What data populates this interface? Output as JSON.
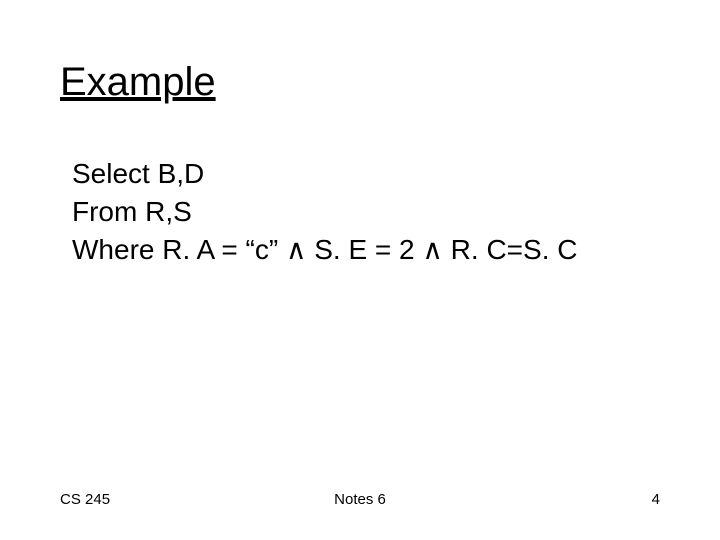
{
  "title": "Example",
  "body": {
    "line1": "Select B,D",
    "line2": "From R,S",
    "line3": "Where R. A = “c”  ∧  S. E = 2  ∧  R. C=S. C"
  },
  "footer": {
    "left": "CS 245",
    "center": "Notes 6",
    "right": "4"
  }
}
